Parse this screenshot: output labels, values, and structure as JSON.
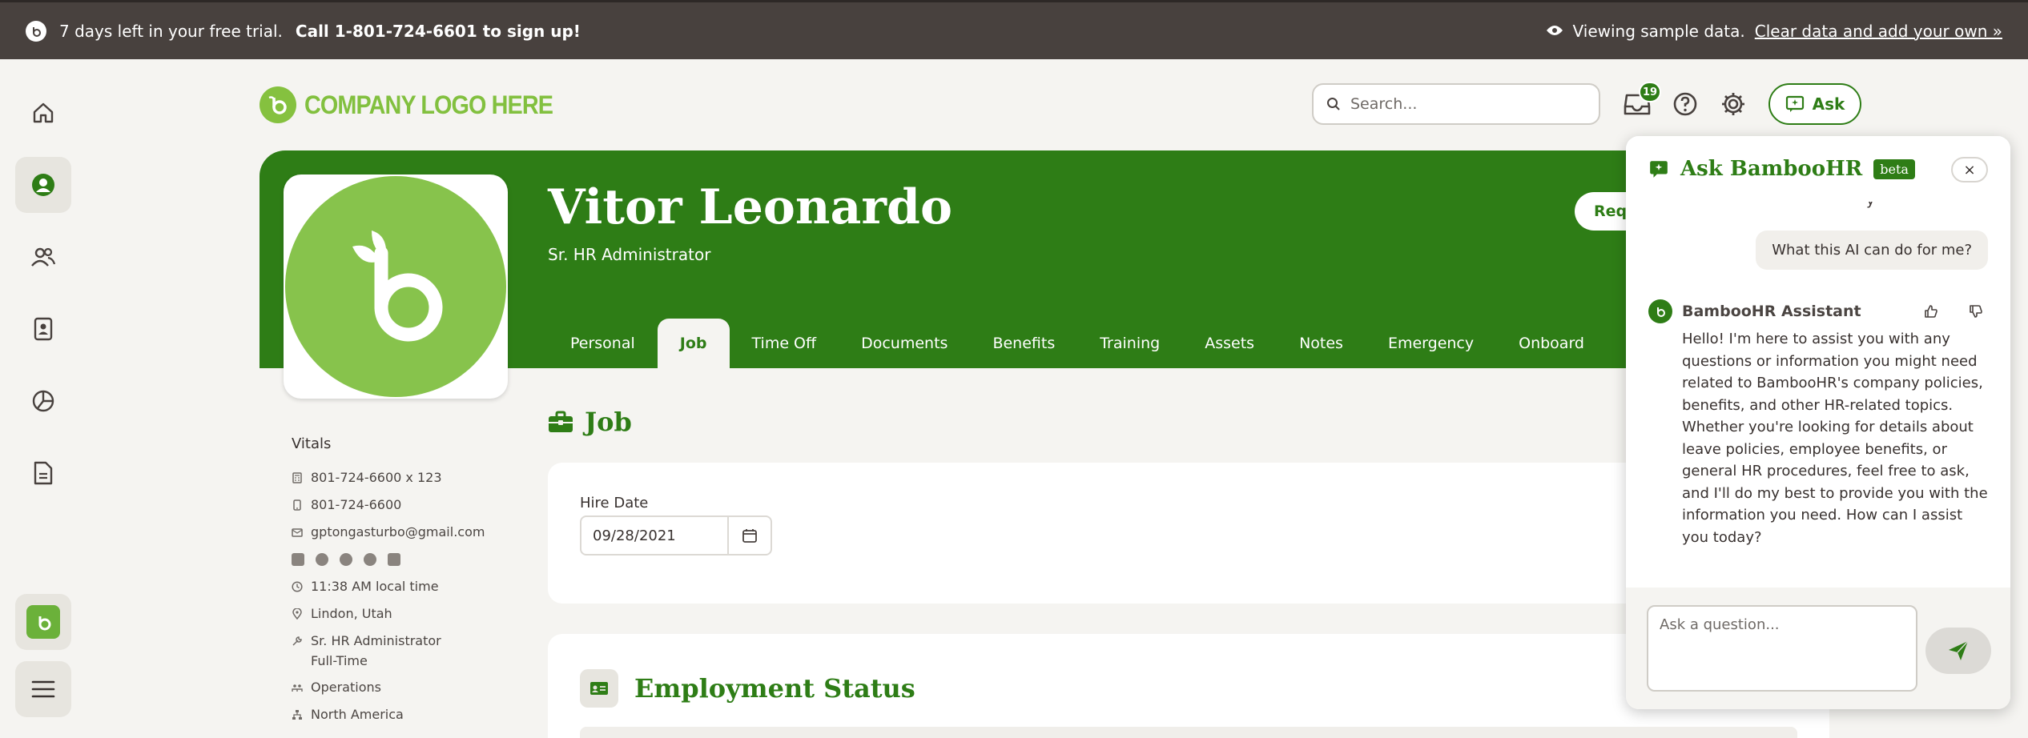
{
  "banner": {
    "trial_prefix": "7 days left in your free trial.",
    "trial_cta": "Call 1-801-724-6601 to sign up!",
    "sample_text": "Viewing sample data.",
    "sample_link": "Clear data and add your own »"
  },
  "header": {
    "logo_text": "COMPANY LOGO HERE",
    "search_placeholder": "Search...",
    "inbox_count": "19",
    "ask_label": "Ask"
  },
  "profile": {
    "name": "Vitor Leonardo",
    "title": "Sr. HR Administrator",
    "request_label": "Requ"
  },
  "tabs": [
    {
      "label": "Personal"
    },
    {
      "label": "Job"
    },
    {
      "label": "Time Off"
    },
    {
      "label": "Documents"
    },
    {
      "label": "Benefits"
    },
    {
      "label": "Training"
    },
    {
      "label": "Assets"
    },
    {
      "label": "Notes"
    },
    {
      "label": "Emergency"
    },
    {
      "label": "Onboard"
    }
  ],
  "vitals": {
    "heading": "Vitals",
    "work_phone": "801-724-6600 x 123",
    "mobile_phone": "801-724-6600",
    "email": "gptongasturbo@gmail.com",
    "local_time": "11:38 AM local time",
    "location": "Lindon, Utah",
    "job_title": "Sr. HR Administrator",
    "employment_type": "Full-Time",
    "department": "Operations",
    "division": "North America"
  },
  "job": {
    "section_title": "Job",
    "hire_date_label": "Hire Date",
    "hire_date_value": "09/28/2021",
    "employment_status_title": "Employment Status"
  },
  "chat": {
    "title": "Ask BambooHR",
    "beta": "beta",
    "close": "×",
    "cut_text": "y",
    "user_message": "What this AI can do for me?",
    "assistant_name": "BambooHR Assistant",
    "assistant_message": "Hello! I'm here to assist you with any questions or information you might need related to BambooHR's company policies, benefits, and other HR-related topics. Whether you're looking for details about leave policies, employee benefits, or general HR procedures, feel free to ask, and I'll do my best to provide you with the information you need. How can I assist you today?",
    "input_placeholder": "Ask a question..."
  },
  "colors": {
    "brand_green": "#2e7d16",
    "logo_green": "#82c03f",
    "banner_bg": "#48413e",
    "page_bg": "#f5f4f1"
  }
}
